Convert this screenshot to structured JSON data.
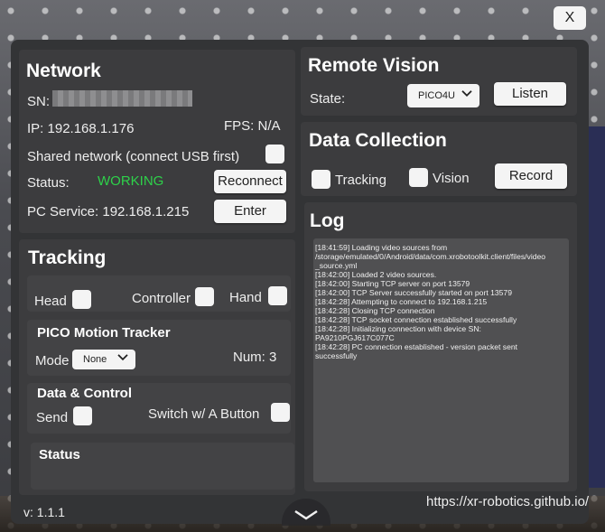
{
  "close_label": "X",
  "network": {
    "title": "Network",
    "sn_label": "SN:",
    "ip_label": "IP: 192.168.1.176",
    "fps_label": "FPS: N/A",
    "shared_label": "Shared network (connect USB first)",
    "status_label": "Status:",
    "status_value": "WORKING",
    "status_color": "#2ed14a",
    "reconnect_label": "Reconnect",
    "pc_service_label": "PC Service: 192.168.1.215",
    "enter_label": "Enter"
  },
  "tracking": {
    "title": "Tracking",
    "head_label": "Head",
    "controller_label": "Controller",
    "hand_label": "Hand",
    "motion_tracker_title": "PICO Motion Tracker",
    "mode_label": "Mode",
    "mode_value": "None",
    "num_label": "Num: 3",
    "data_control_title": "Data & Control",
    "send_label": "Send",
    "switch_label": "Switch w/ A Button",
    "status_title": "Status"
  },
  "remote_vision": {
    "title": "Remote Vision",
    "state_label": "State:",
    "state_value": "PICO4U",
    "listen_label": "Listen"
  },
  "data_collection": {
    "title": "Data Collection",
    "tracking_label": "Tracking",
    "vision_label": "Vision",
    "record_label": "Record"
  },
  "log": {
    "title": "Log",
    "lines": [
      "[18:41:59] Loading video sources from",
      "/storage/emulated/0/Android/data/com.xrobotoolkit.client/files/video",
      "_source.yml",
      "[18:42:00] Loaded 2 video sources.",
      "[18:42:00] Starting TCP server on port 13579",
      "[18:42:00] TCP Server successfully started on port 13579",
      "[18:42:28] Attempting to connect to 192.168.1.215",
      "[18:42:28] Closing TCP connection",
      "[18:42:28] TCP socket connection established successfully",
      "[18:42:28] Initializing connection with device SN:",
      "PA9210PGJ617C077C",
      "[18:42:28] PC connection established - version packet sent",
      "successfully"
    ]
  },
  "footer": {
    "version": "v: 1.1.1",
    "url": "https://xr-robotics.github.io/"
  }
}
